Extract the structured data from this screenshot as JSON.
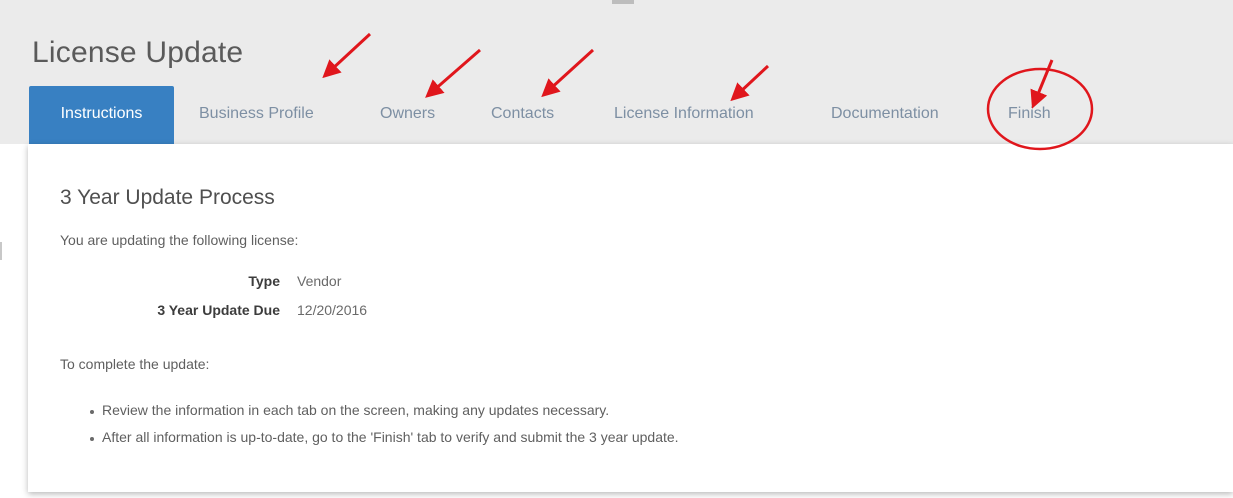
{
  "page": {
    "title": "License Update"
  },
  "tabs": [
    {
      "label": "Instructions",
      "active": true
    },
    {
      "label": "Business Profile",
      "active": false
    },
    {
      "label": "Owners",
      "active": false
    },
    {
      "label": "Contacts",
      "active": false
    },
    {
      "label": "License Information",
      "active": false
    },
    {
      "label": "Documentation",
      "active": false
    },
    {
      "label": "Finish",
      "active": false
    }
  ],
  "content": {
    "heading": "3 Year Update Process",
    "intro": "You are updating the following license:",
    "details": [
      {
        "label": "Type",
        "value": "Vendor"
      },
      {
        "label": "3 Year Update Due",
        "value": "12/20/2016"
      }
    ],
    "complete_text": "To complete the update:",
    "steps": [
      "Review the information in each tab on the screen, making any updates necessary.",
      "After all information is up-to-date, go to the 'Finish' tab to verify and submit the 3 year update."
    ]
  },
  "colors": {
    "active_tab": "#3880c2",
    "tab_text": "#7d8fa3",
    "annotation_red": "#e0161c",
    "header_band": "#ebebeb"
  },
  "icons": {
    "annotation_arrow": "arrow-icon",
    "annotation_circle": "highlight-circle"
  }
}
